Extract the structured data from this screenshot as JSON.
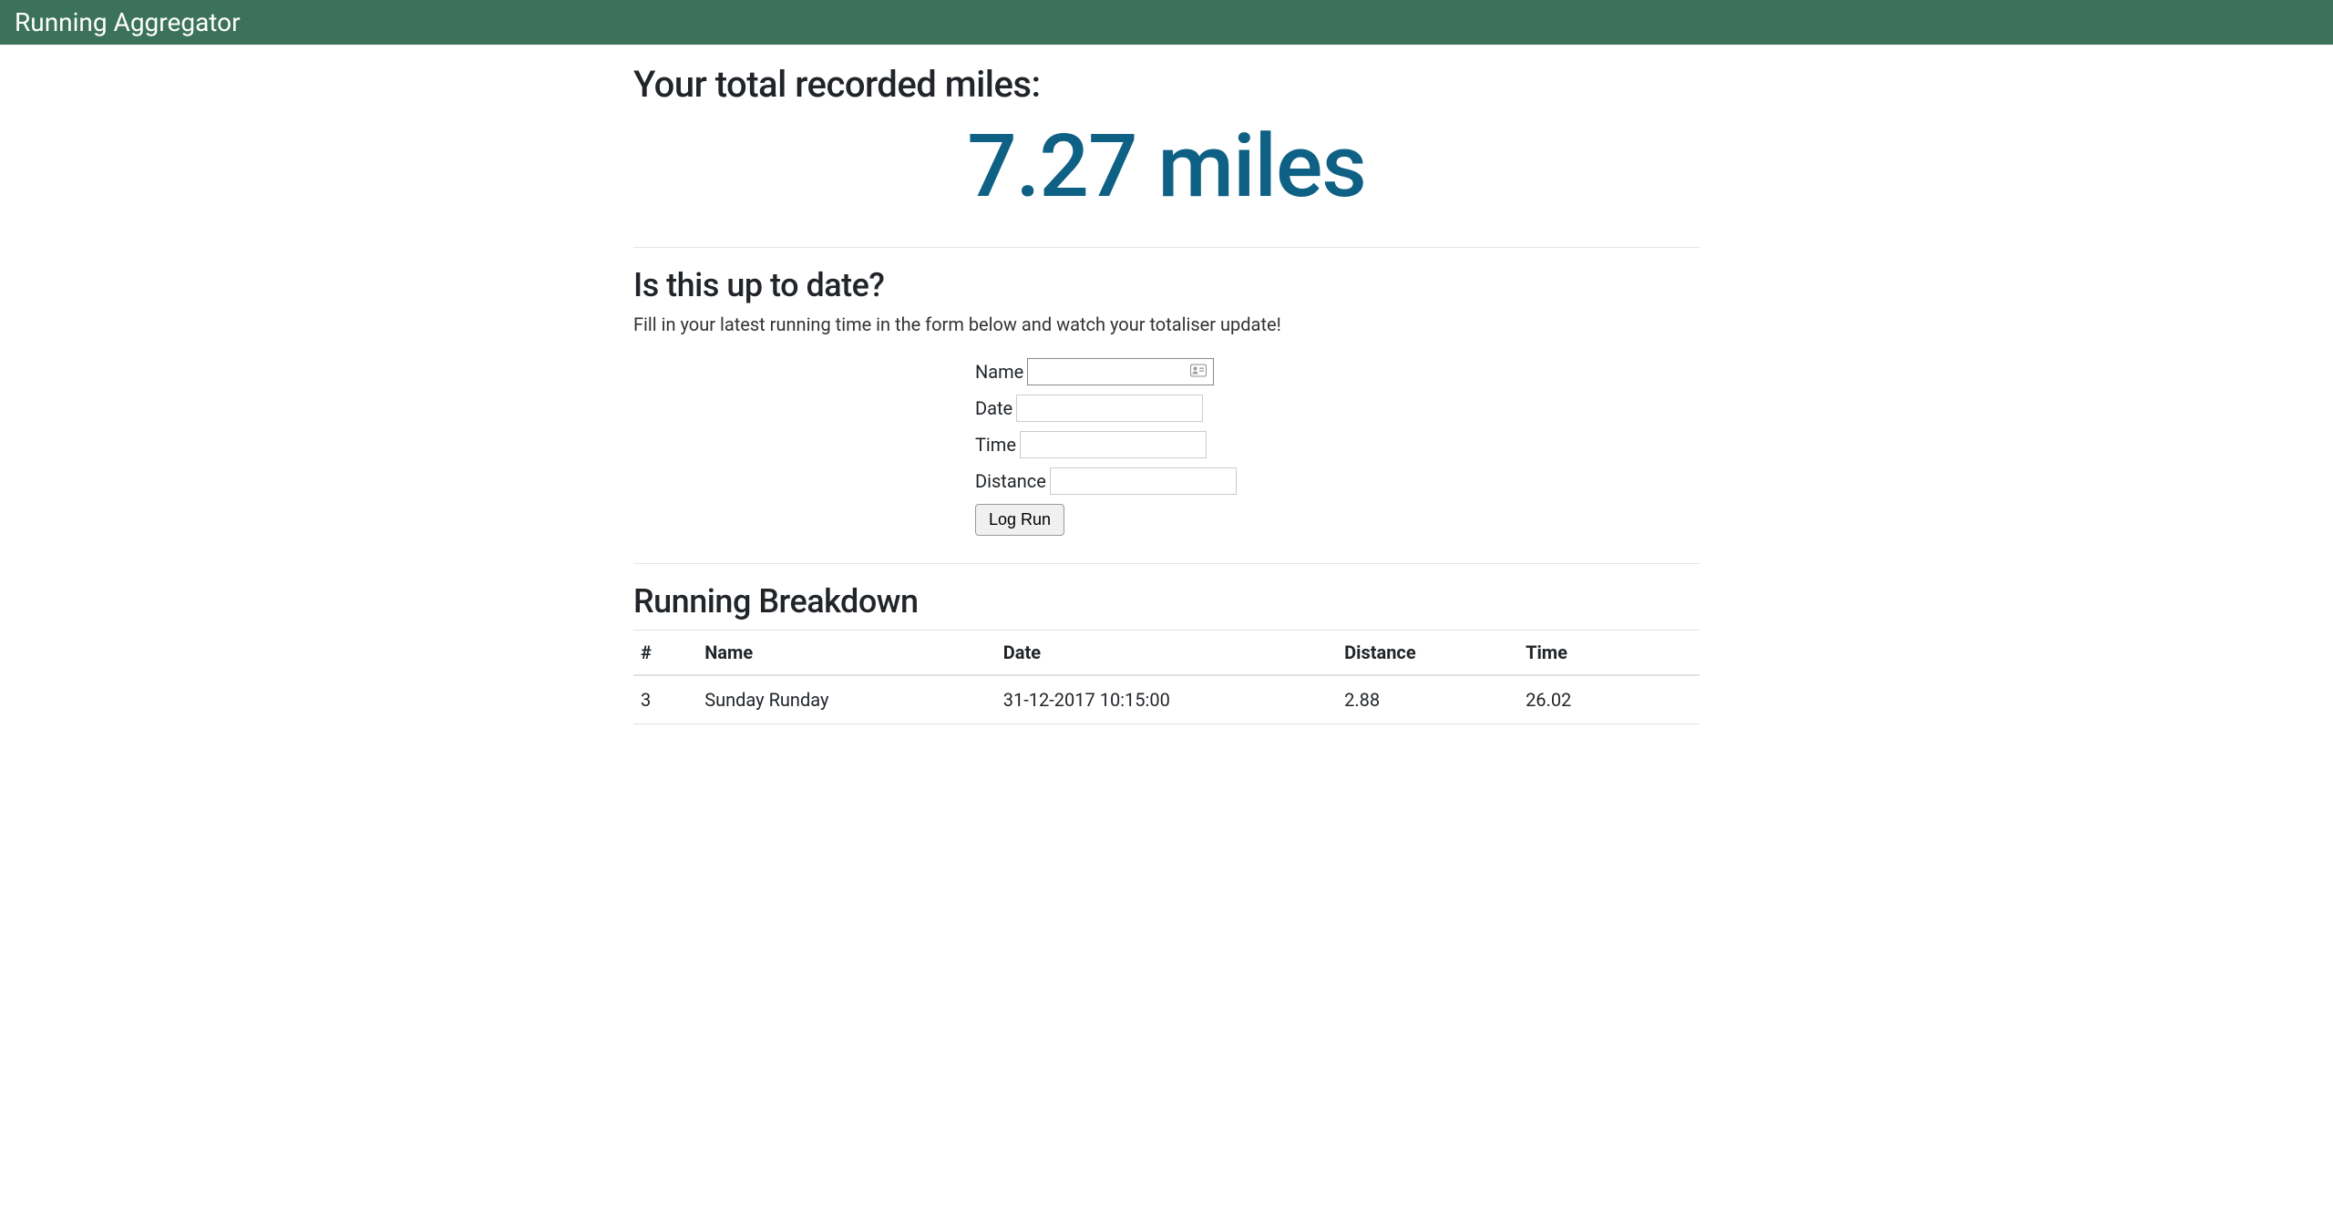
{
  "navbar": {
    "brand": "Running Aggregator"
  },
  "totaliser": {
    "heading": "Your total recorded miles:",
    "value": "7.27 miles"
  },
  "update_section": {
    "heading": "Is this up to date?",
    "lead": "Fill in your latest running time in the form below and watch your totaliser update!",
    "form": {
      "name_label": "Name",
      "date_label": "Date",
      "time_label": "Time",
      "distance_label": "Distance",
      "submit_label": "Log Run",
      "name_value": "",
      "date_value": "",
      "time_value": "",
      "distance_value": ""
    }
  },
  "breakdown": {
    "heading": "Running Breakdown",
    "columns": {
      "index": "#",
      "name": "Name",
      "date": "Date",
      "distance": "Distance",
      "time": "Time"
    },
    "rows": [
      {
        "index": "3",
        "name": "Sunday Runday",
        "date": "31-12-2017 10:15:00",
        "distance": "2.88",
        "time": "26.02"
      }
    ]
  }
}
